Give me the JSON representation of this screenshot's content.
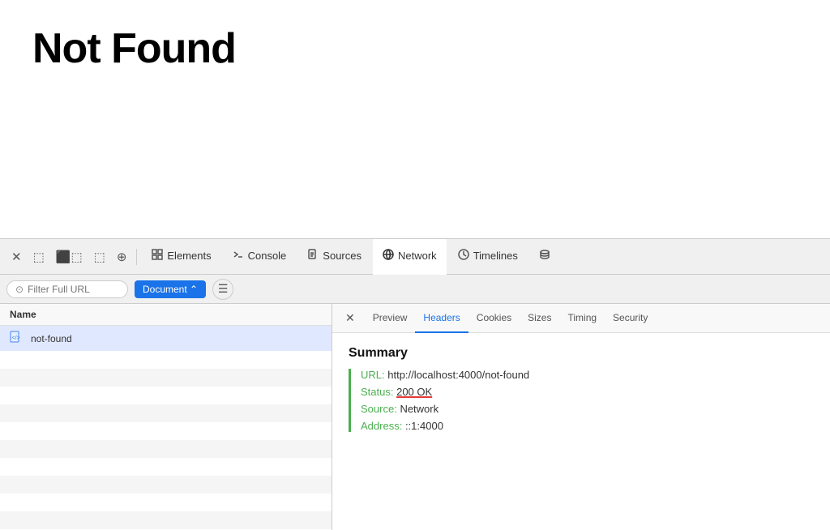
{
  "page": {
    "title": "Not Found"
  },
  "devtools": {
    "toolbar": {
      "close_label": "✕",
      "inspect_label": "⬚",
      "split_label": "⬚⬚",
      "dock_label": "⬚",
      "target_label": "⊕",
      "elements_label": "Elements",
      "console_label": "Console",
      "sources_label": "Sources",
      "network_label": "Network",
      "timelines_label": "Timelines",
      "storage_label": "≡"
    },
    "filter": {
      "placeholder": "Filter Full URL",
      "document_label": "Document ⌃",
      "list_icon": "☰"
    },
    "request_list": {
      "column_header": "Name",
      "items": [
        {
          "name": "not-found",
          "icon": "📄"
        }
      ]
    },
    "details": {
      "close_label": "✕",
      "tabs": [
        {
          "id": "preview",
          "label": "Preview",
          "active": false
        },
        {
          "id": "headers",
          "label": "Headers",
          "active": true
        },
        {
          "id": "cookies",
          "label": "Cookies",
          "active": false
        },
        {
          "id": "sizes",
          "label": "Sizes",
          "active": false
        },
        {
          "id": "timing",
          "label": "Timing",
          "active": false
        },
        {
          "id": "security",
          "label": "Security",
          "active": false
        }
      ],
      "summary": {
        "title": "Summary",
        "fields": [
          {
            "label": "URL:",
            "value": "http://localhost:4000/not-found",
            "id": "url"
          },
          {
            "label": "Status:",
            "value": "200 OK",
            "id": "status",
            "underline": true
          },
          {
            "label": "Source:",
            "value": "Network",
            "id": "source"
          },
          {
            "label": "Address:",
            "value": "::1:4000",
            "id": "address"
          }
        ]
      }
    }
  },
  "colors": {
    "active_tab_text": "#1a73e8",
    "document_btn_bg": "#1a73e8",
    "green_label": "#4caf50",
    "status_underline": "#e53935"
  }
}
